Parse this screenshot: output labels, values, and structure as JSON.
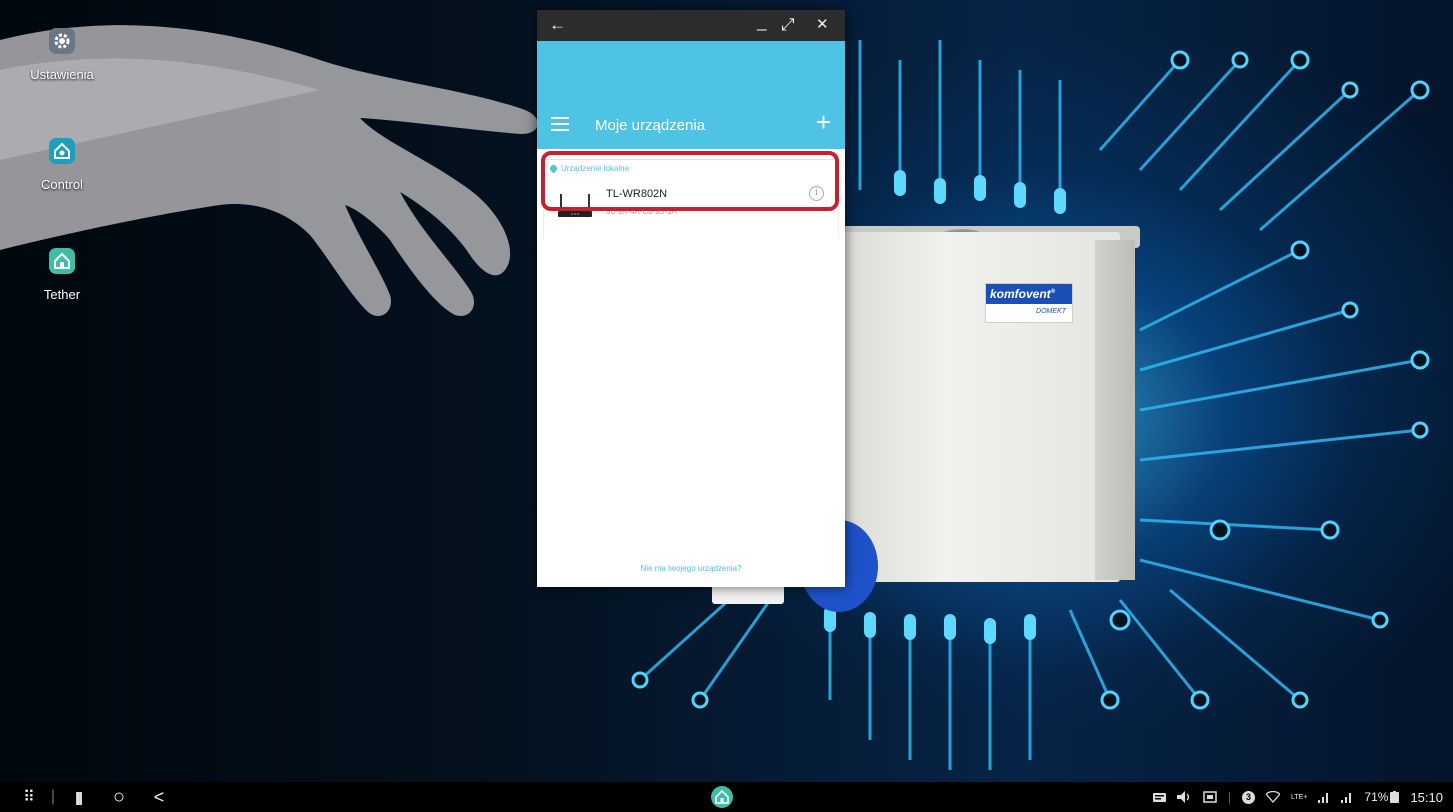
{
  "desktop": {
    "icons": [
      {
        "label": "Ustawienia",
        "icon": "settings-gear-icon",
        "color": "#6a7684"
      },
      {
        "label": "Control",
        "icon": "komfovent-control-icon",
        "color": "#1e9dbd"
      },
      {
        "label": "Tether",
        "icon": "tether-home-icon",
        "color": "#3dbfa7"
      }
    ],
    "wallpaper_brand": {
      "name": "komfovent",
      "trademark": "®",
      "model": "DOMEKT"
    }
  },
  "window": {
    "titlebar": {
      "back": "←",
      "minimize": "_",
      "pin": "⤢",
      "close": "✕"
    },
    "appbar": {
      "title": "Moje urządzenia",
      "add": "+"
    },
    "section": {
      "title": "Urządzenie lokalne"
    },
    "devices": [
      {
        "name": "TL-WR802N",
        "mac": "90-9A-4A-C8-93-3A",
        "info_icon": "i"
      }
    ],
    "footer_link": "Nie ma twojego urządzenia?"
  },
  "taskbar": {
    "apps_icon": "⠿",
    "recents": "|||",
    "home": "○",
    "back": "<",
    "status": {
      "battery": "71%",
      "time": "15:10",
      "notification_count": "3",
      "network": "LTE+"
    }
  },
  "colors": {
    "accent": "#4ec3e3",
    "highlight": "#c9202f",
    "titlebar": "#2c2c2c",
    "taskbar": "#000000"
  }
}
